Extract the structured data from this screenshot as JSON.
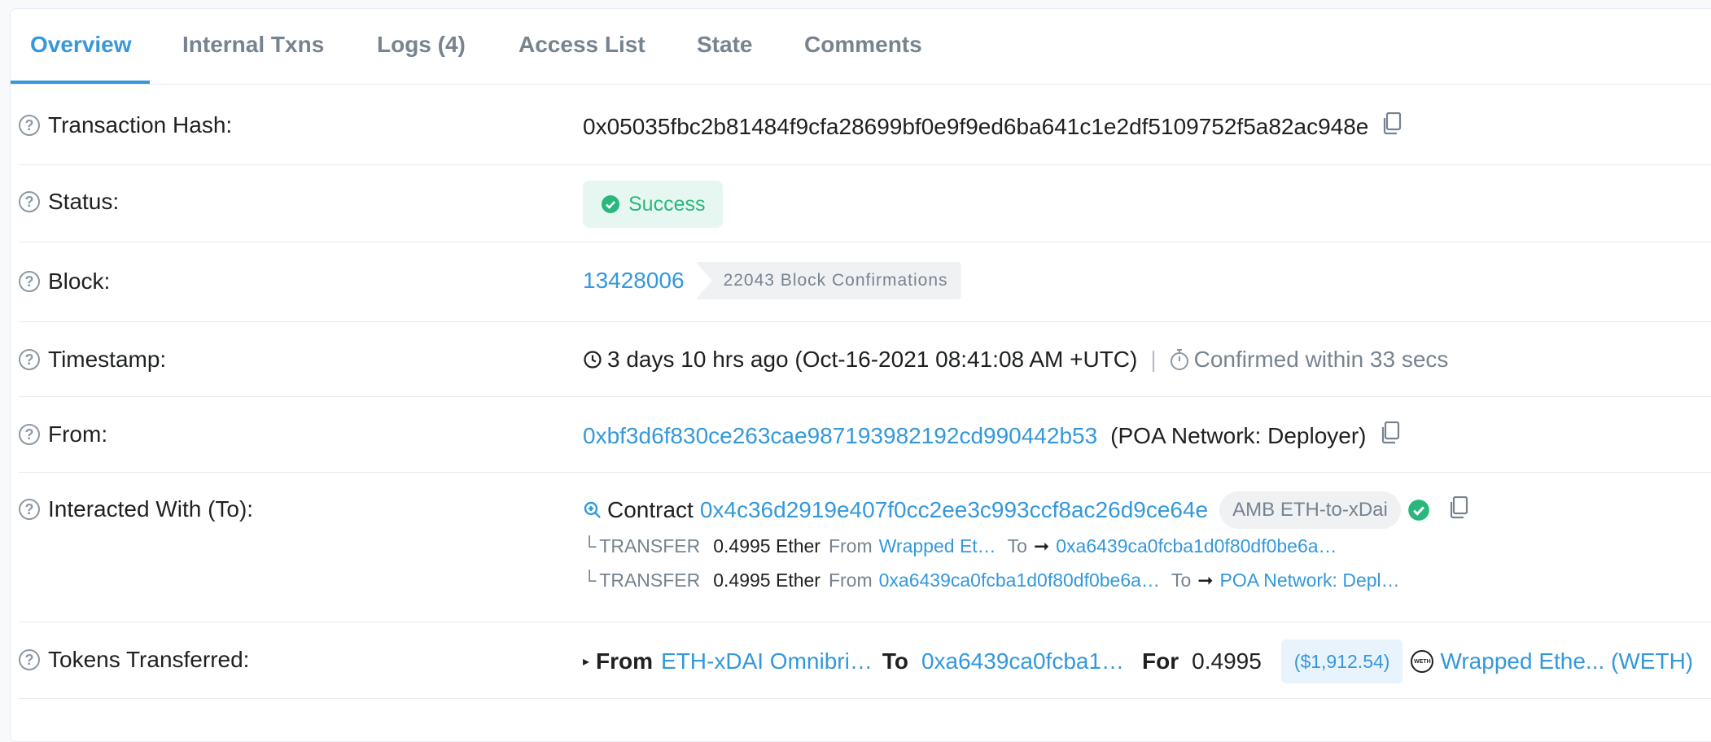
{
  "tabs": [
    "Overview",
    "Internal Txns",
    "Logs (4)",
    "Access List",
    "State",
    "Comments"
  ],
  "tx_hash": {
    "label": "Transaction Hash:",
    "value": "0x05035fbc2b81484f9cfa28699bf0e9f9ed6ba641c1e2df5109752f5a82ac948e"
  },
  "status": {
    "label": "Status:",
    "value": "Success"
  },
  "block": {
    "label": "Block:",
    "number": "13428006",
    "confirmations": "22043 Block Confirmations"
  },
  "timestamp": {
    "label": "Timestamp:",
    "value": "3 days 10 hrs ago (Oct-16-2021 08:41:08 AM +UTC)",
    "confirmed": "Confirmed within 33 secs"
  },
  "from": {
    "label": "From:",
    "address": "0xbf3d6f830ce263cae987193982192cd990442b53",
    "name": "(POA Network: Deployer)"
  },
  "interacted": {
    "label": "Interacted With (To):",
    "contract_word": "Contract",
    "address": "0x4c36d2919e407f0cc2ee3c993ccf8ac26d9ce64e",
    "tag": "AMB ETH-to-xDai",
    "transfers": [
      {
        "type": "TRANSFER",
        "amount": "0.4995 Ether",
        "from_word": "From",
        "from": "Wrapped Et…",
        "to_word": "To",
        "to": "0xa6439ca0fcba1d0f80df0be6a…"
      },
      {
        "type": "TRANSFER",
        "amount": "0.4995 Ether",
        "from_word": "From",
        "from": "0xa6439ca0fcba1d0f80df0be6a…",
        "to_word": "To",
        "to": "POA Network: Depl…"
      }
    ]
  },
  "tokens": {
    "label": "Tokens Transferred:",
    "from_word": "From",
    "from": "ETH-xDAI Omnibri…",
    "to_word": "To",
    "to": "0xa6439ca0fcba1…",
    "for_word": "For",
    "amount": "0.4995",
    "usd": "($1,912.54)",
    "token": "Wrapped Ethe... (WETH)",
    "token_logo_text": "WETH"
  },
  "colors": {
    "accent": "#3498db",
    "success": "#2ab77e",
    "muted": "#77838f"
  }
}
